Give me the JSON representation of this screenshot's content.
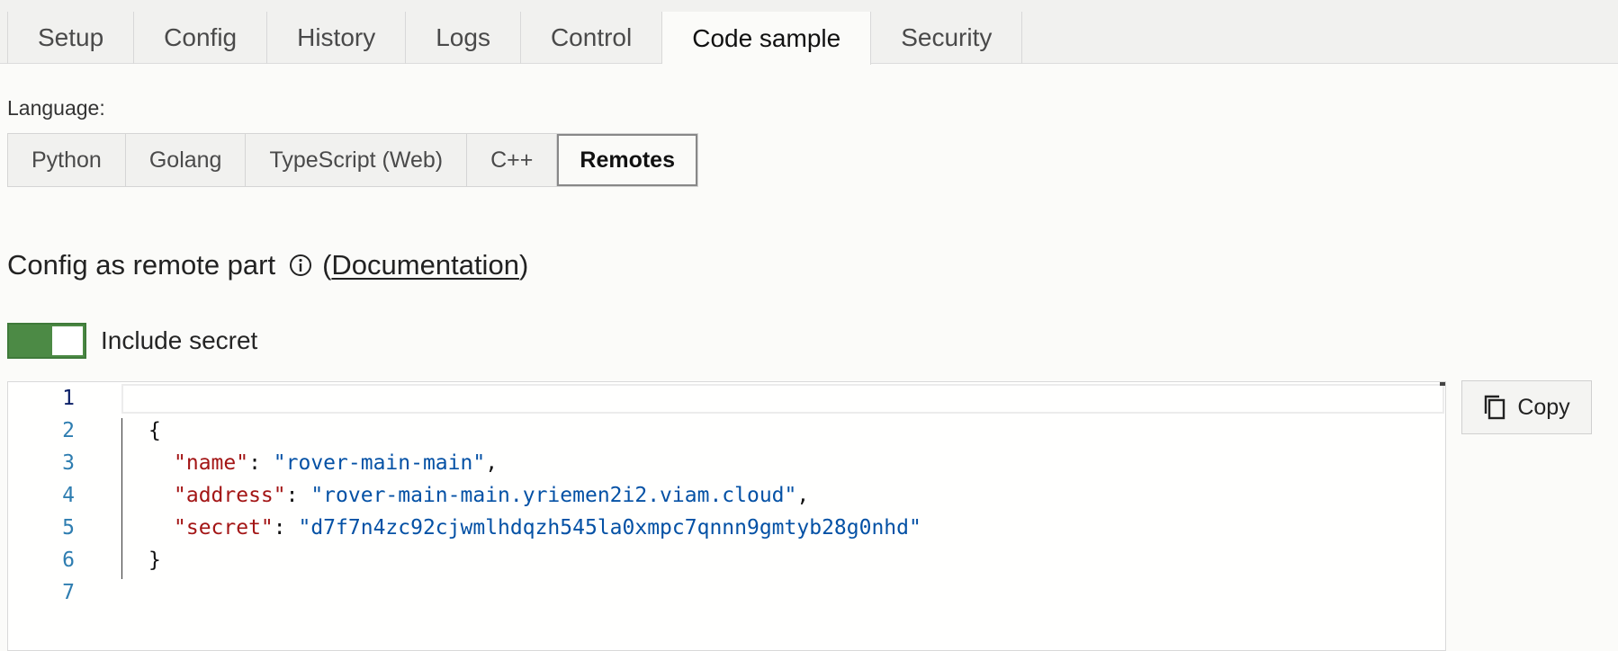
{
  "tabs": [
    {
      "label": "Setup",
      "active": false
    },
    {
      "label": "Config",
      "active": false
    },
    {
      "label": "History",
      "active": false
    },
    {
      "label": "Logs",
      "active": false
    },
    {
      "label": "Control",
      "active": false
    },
    {
      "label": "Code sample",
      "active": true
    },
    {
      "label": "Security",
      "active": false
    }
  ],
  "language": {
    "label": "Language:",
    "options": [
      {
        "label": "Python",
        "active": false
      },
      {
        "label": "Golang",
        "active": false
      },
      {
        "label": "TypeScript (Web)",
        "active": false
      },
      {
        "label": "C++",
        "active": false
      },
      {
        "label": "Remotes",
        "active": true
      }
    ]
  },
  "section": {
    "title": "Config as remote part",
    "doc_open": "(",
    "doc_link": "Documentation",
    "doc_close": ")",
    "info_icon": "info-icon"
  },
  "toggle": {
    "label": "Include secret",
    "on": true,
    "color": "#4c8a45"
  },
  "editor": {
    "current_line": 1,
    "lines": [
      {
        "num": "1"
      },
      {
        "num": "2",
        "text": "{"
      },
      {
        "num": "3",
        "key": "\"name\"",
        "sep": ": ",
        "value": "\"rover-main-main\"",
        "end": ","
      },
      {
        "num": "4",
        "key": "\"address\"",
        "sep": ": ",
        "value": "\"rover-main-main.yriemen2i2.viam.cloud\"",
        "end": ","
      },
      {
        "num": "5",
        "key": "\"secret\"",
        "sep": ": ",
        "value": "\"d7f7n4zc92cjwmlhdqzh545la0xmpc7qnnn9gmtyb28g0nhd\"",
        "end": ""
      },
      {
        "num": "6",
        "text": "}"
      },
      {
        "num": "7"
      }
    ],
    "colors": {
      "key": "#a31515",
      "string": "#0451a5",
      "line_number": "#2e7db0"
    }
  },
  "copy_button": {
    "label": "Copy",
    "icon": "copy-icon"
  }
}
